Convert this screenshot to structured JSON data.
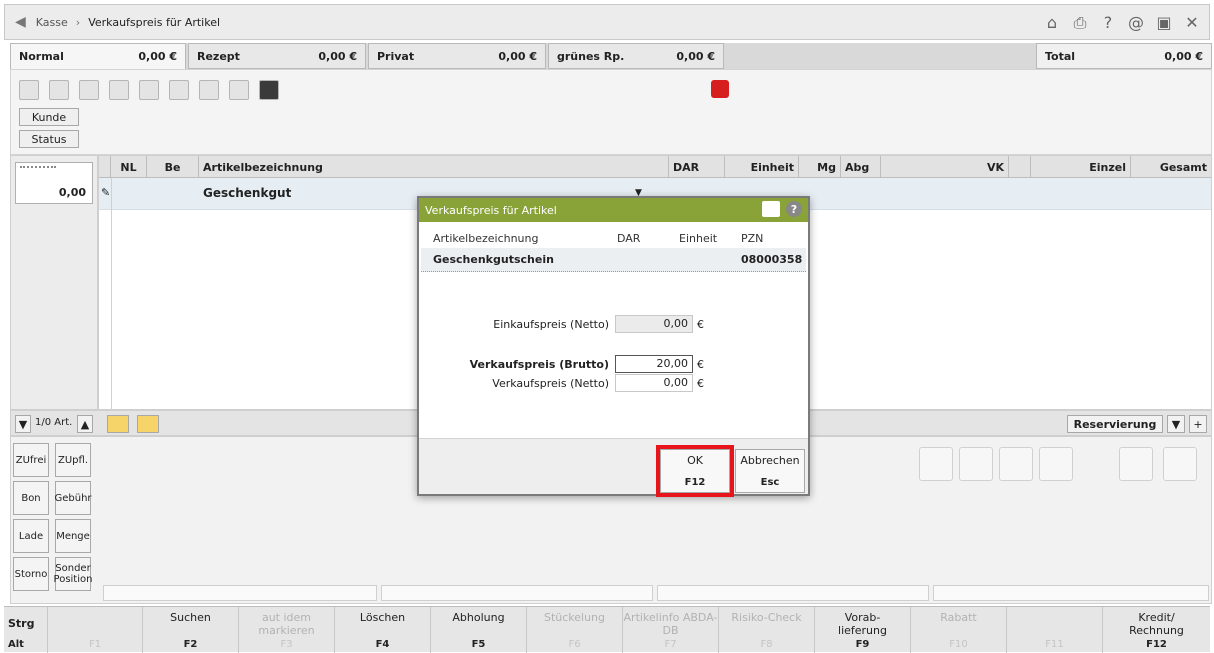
{
  "titlebar": {
    "crumb": "Kasse",
    "separator": "›",
    "title": "Verkaufspreis für Artikel",
    "icons": [
      "home-icon",
      "print-icon",
      "help-icon",
      "at-icon",
      "window-icon",
      "close-icon"
    ],
    "help_glyph": "?",
    "at_glyph": "@",
    "close_glyph": "✕"
  },
  "tabs": [
    {
      "label": "Normal",
      "amount": "0,00 €"
    },
    {
      "label": "Rezept",
      "amount": "0,00 €"
    },
    {
      "label": "Privat",
      "amount": "0,00 €"
    },
    {
      "label": "grünes Rp.",
      "amount": "0,00 €"
    }
  ],
  "total": {
    "label": "Total",
    "amount": "0,00 €"
  },
  "toolbar": {
    "kunde": "Kunde",
    "status": "Status"
  },
  "left_panel": {
    "value": "0,00"
  },
  "grid": {
    "headers": [
      "NL",
      "Be",
      "Artikelbezeichnung",
      "DAR",
      "Einheit",
      "Mg",
      "Abg",
      "VK",
      "Einzel",
      "Gesamt"
    ],
    "row": {
      "artikel": "Geschenkgut"
    }
  },
  "navbar": {
    "count": "1/0 Art.",
    "reservierung": "Reservierung"
  },
  "side_buttons": [
    [
      "ZUfrei",
      "ZUpfl."
    ],
    [
      "Bon",
      "Gebühr"
    ],
    [
      "Lade",
      "Menge"
    ],
    [
      "Storno",
      "Sonder Position"
    ]
  ],
  "fkeys": [
    {
      "label": "Strg",
      "key": "Alt",
      "enabled": true
    },
    {
      "label": "",
      "key": "F1",
      "enabled": false
    },
    {
      "label": "Suchen",
      "key": "F2",
      "enabled": true
    },
    {
      "label": "aut idem markieren",
      "key": "F3",
      "enabled": false
    },
    {
      "label": "Löschen",
      "key": "F4",
      "enabled": true
    },
    {
      "label": "Abholung",
      "key": "F5",
      "enabled": true
    },
    {
      "label": "Stückelung",
      "key": "F6",
      "enabled": false
    },
    {
      "label": "Artikelinfo ABDA-DB",
      "key": "F7",
      "enabled": false
    },
    {
      "label": "Risiko-Check",
      "key": "F8",
      "enabled": false
    },
    {
      "label": "Vorab-lieferung",
      "key": "F9",
      "enabled": true
    },
    {
      "label": "Rabatt",
      "key": "F10",
      "enabled": false
    },
    {
      "label": "",
      "key": "F11",
      "enabled": false
    },
    {
      "label": "Kredit/ Rechnung",
      "key": "F12",
      "enabled": true
    }
  ],
  "dialog": {
    "title": "Verkaufspreis für Artikel",
    "help": "?",
    "col_artikel": "Artikelbezeichnung",
    "col_dar": "DAR",
    "col_einheit": "Einheit",
    "col_pzn": "PZN",
    "artikel": "Geschenkgutschein",
    "pzn": "08000358",
    "einkauf_label": "Einkaufspreis (Netto)",
    "einkauf_value": "0,00",
    "vk_brutto_label": "Verkaufspreis (Brutto)",
    "vk_brutto_value": "20,00",
    "vk_netto_label": "Verkaufspreis (Netto)",
    "vk_netto_value": "0,00",
    "currency": "€",
    "ok_label": "OK",
    "ok_key": "F12",
    "cancel_label": "Abbrechen",
    "cancel_key": "Esc"
  },
  "colors": {
    "dialog_header": "#8aa338",
    "highlight_frame": "#e8141b",
    "stop_square": "#d61e1e"
  }
}
